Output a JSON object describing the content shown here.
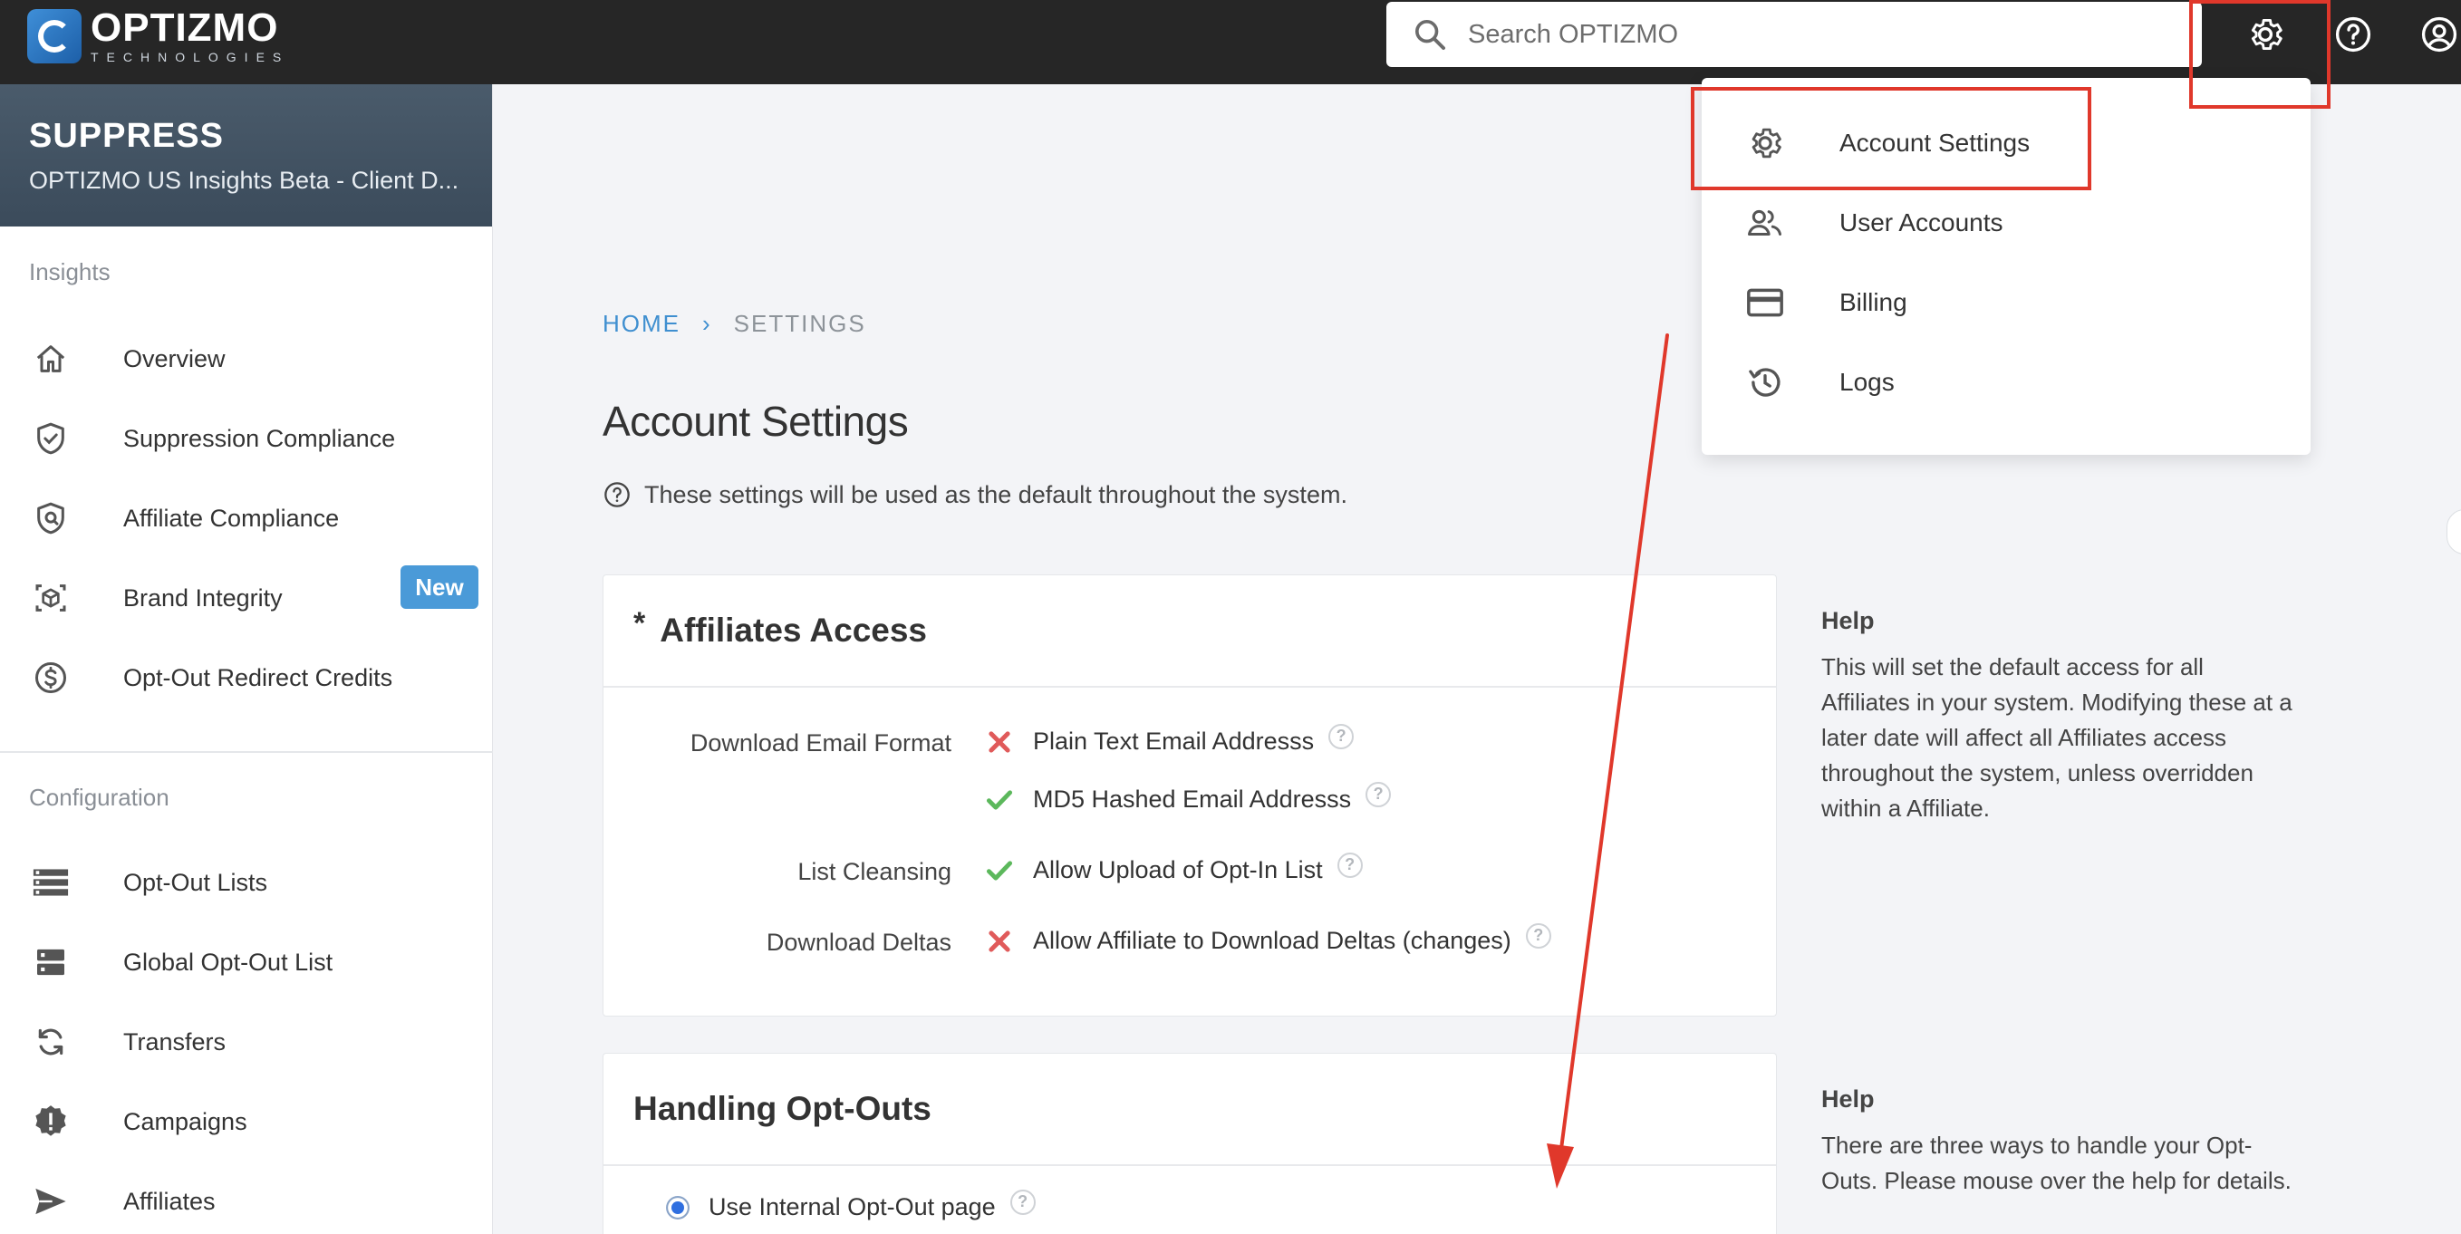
{
  "topbar": {
    "logo_name": "OPTIZMO",
    "logo_sub": "TECHNOLOGIES",
    "search_placeholder": "Search OPTIZMO",
    "icons": [
      "gear-icon",
      "help-icon",
      "user-account-icon"
    ]
  },
  "sidebar": {
    "title": "SUPPRESS",
    "subtitle": "OPTIZMO US Insights Beta - Client D...",
    "sections": [
      {
        "label": "Insights",
        "items": [
          {
            "label": "Overview",
            "icon": "home-icon"
          },
          {
            "label": "Suppression Compliance",
            "icon": "shield-check-icon"
          },
          {
            "label": "Affiliate Compliance",
            "icon": "shield-search-icon"
          },
          {
            "label": "Brand Integrity",
            "icon": "cube-scan-icon",
            "badge": "New"
          },
          {
            "label": "Opt-Out Redirect Credits",
            "icon": "dollar-circle-icon"
          }
        ]
      },
      {
        "label": "Configuration",
        "items": [
          {
            "label": "Opt-Out Lists",
            "icon": "list-icon"
          },
          {
            "label": "Global Opt-Out List",
            "icon": "server-icon"
          },
          {
            "label": "Transfers",
            "icon": "sync-icon"
          },
          {
            "label": "Campaigns",
            "icon": "alert-badge-icon"
          },
          {
            "label": "Affiliates",
            "icon": "send-icon"
          }
        ]
      }
    ]
  },
  "breadcrumb": {
    "home": "HOME",
    "separator": "›",
    "current": "SETTINGS"
  },
  "page": {
    "title": "Account Settings",
    "description": "These settings will be used as the default throughout the system."
  },
  "affiliates_access": {
    "star": "*",
    "title": "Affiliates Access",
    "rows": [
      {
        "label": "Download Email Format",
        "options": [
          {
            "text": "Plain Text Email Addresss",
            "state": "off"
          },
          {
            "text": "MD5 Hashed Email Addresss",
            "state": "on"
          }
        ]
      },
      {
        "label": "List Cleansing",
        "options": [
          {
            "text": "Allow Upload of Opt-In List",
            "state": "on"
          }
        ]
      },
      {
        "label": "Download Deltas",
        "options": [
          {
            "text": "Allow Affiliate to Download Deltas (changes)",
            "state": "off"
          }
        ]
      }
    ],
    "help_title": "Help",
    "help_text": "This will set the default access for all Affiliates in your system. Modifying these at a later date will affect all Affiliates access throughout the system, unless overridden within a Affiliate."
  },
  "handling_optouts": {
    "title": "Handling Opt-Outs",
    "option1": "Use Internal Opt-Out page",
    "help_title": "Help",
    "help_text": "There are three ways to handle your Opt-Outs. Please mouse over the help for details."
  },
  "dropdown": {
    "items": [
      {
        "label": "Account Settings",
        "icon": "gear-icon"
      },
      {
        "label": "User Accounts",
        "icon": "users-icon"
      },
      {
        "label": "Billing",
        "icon": "credit-card-icon"
      },
      {
        "label": "Logs",
        "icon": "history-icon"
      }
    ]
  },
  "colors": {
    "accent": "#3f8fd0",
    "annotation": "#e0382b",
    "check": "#5cb85c",
    "cross": "#e05a5a"
  }
}
